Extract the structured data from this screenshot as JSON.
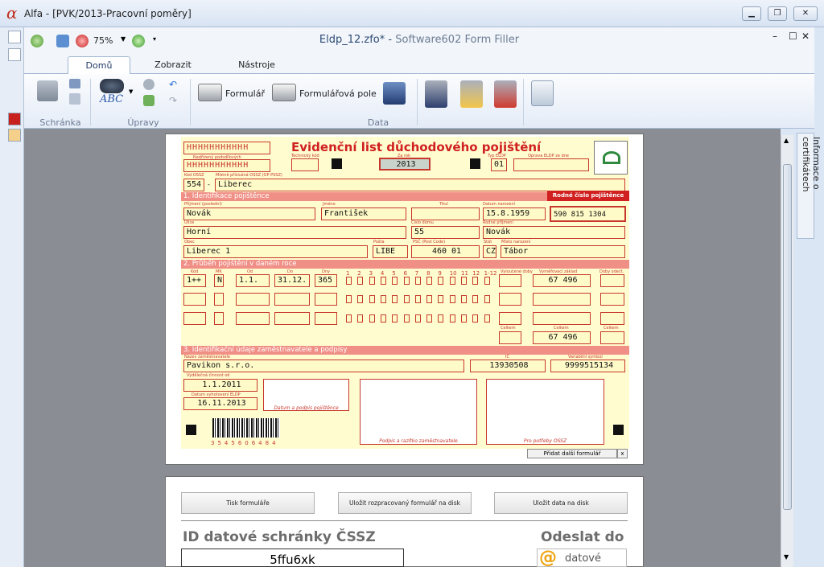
{
  "window": {
    "title": "Alfa - [PVK/2013-Pracovní poměry]",
    "alpha": "α",
    "min": "▁",
    "restore": "❐",
    "close": "✕"
  },
  "filler": {
    "zoom": "75%",
    "doc": "Eldp_12.zfo* -",
    "app": "Software602 Form Filler",
    "min": "–",
    "restore": "☐",
    "close": "✕"
  },
  "tabs": [
    "Domů",
    "Zobrazit",
    "Nástroje"
  ],
  "ribbon": {
    "groups": [
      "Schránka",
      "Úpravy",
      "Data"
    ],
    "formular": "Formulář",
    "formularova_pole": "Formulářová pole",
    "abc": "ABC"
  },
  "sidepanel": "Informace o certifikátech",
  "form": {
    "title": "Evidenční list důchodového pojištění",
    "hh1": "HHHHHHHHHHH",
    "hh2": "HHHHHHHHHHH",
    "lbl_evid": "Nadřízený podsdílových",
    "lbl_tech": "Technický kód",
    "lbl_rok": "Za rok",
    "lbl_typ": "Typ ELDP",
    "lbl_oprava": "Oprava ELDP ze dne",
    "year": "2013",
    "typ": "01",
    "lbl_kod": "Kód OSSZ",
    "lbl_mist": "Místně příslušná OSSZ (OP PSSZ)",
    "kod": "554",
    "ossz": "Liberec",
    "sec1": "1. Identifikace pojištěnce",
    "rc_title": "Rodné číslo pojištěnce",
    "rc": "590 815 1304",
    "lbl_prijmeni": "Příjmení (poslední)",
    "lbl_jmeno": "Jméno",
    "lbl_titul": "Titul",
    "lbl_datum": "Datum narození",
    "prijmeni": "Novák",
    "jmeno": "František",
    "datum": "15.8.1959",
    "lbl_ulice": "Ulice",
    "lbl_cislo": "Číslo domu",
    "lbl_rodne": "Rodné příjmení",
    "ulice": "Horní",
    "cislo": "55",
    "rodne": "Novák",
    "lbl_obec": "Obec",
    "lbl_posta": "Pošta",
    "lbl_psc": "PSČ (Post Code)",
    "lbl_stat": "Stát",
    "lbl_misto": "Místo narození",
    "obec": "Liberec 1",
    "posta": "LIBE",
    "psc": "460 01",
    "stat": "CZ",
    "misto": "Tábor",
    "sec2": "2. Průběh pojištění v daném roce",
    "lbl_k": "Kód",
    "lbl_mk": "MK",
    "lbl_od": "Od",
    "lbl_do": "Do",
    "lbl_dny": "Dny",
    "lbl_vyl": "Vyloučené doby",
    "lbl_vym": "Vyměřovací základ",
    "lbl_doby": "Doby odečt.",
    "k1": "1++",
    "mk1": "N",
    "od1": "1.1.",
    "do1": "31.12.",
    "dny1": "365",
    "vym1": "67 496",
    "months": [
      "1",
      "2",
      "3",
      "4",
      "5",
      "6",
      "7",
      "8",
      "9",
      "10",
      "11",
      "12",
      "1-12"
    ],
    "lbl_celkem": "Celkem",
    "celkem": "67 496",
    "sec3": "3. Identifikační údaje zaměstnavatele a podpisy",
    "lbl_nazev": "Název zaměstnavatele",
    "lbl_ic": "IČ",
    "lbl_vs": "Variabilní symbol",
    "nazev": "Pavikon s.r.o.",
    "ic": "13930508",
    "vs": "9999515134",
    "lbl_vydel": "Výdělečná činnost od",
    "vydel": "1.1.2011",
    "lbl_vyhot": "Datum vyhotovení ELDP",
    "vyhot": "16.11.2013",
    "cap_podpis": "Datum a podpis pojištěnce",
    "cap_razitko": "Podpis a razítko zaměstnavatele",
    "cap_ossz": "Pro potřeby OSSZ",
    "barcode": "3545606484",
    "pridat": "Přidat další formulář",
    "x": "x"
  },
  "page2": {
    "tisk": "Tisk formuláře",
    "ulozit_rozp": "Uložit rozpracovaný formulář na disk",
    "ulozit_data": "Uložit data na disk",
    "id_title": "ID datové schránky ČSSZ",
    "odeslat": "Odeslat do",
    "id_value": "5ffu6xk",
    "ds_logo": "datové"
  }
}
